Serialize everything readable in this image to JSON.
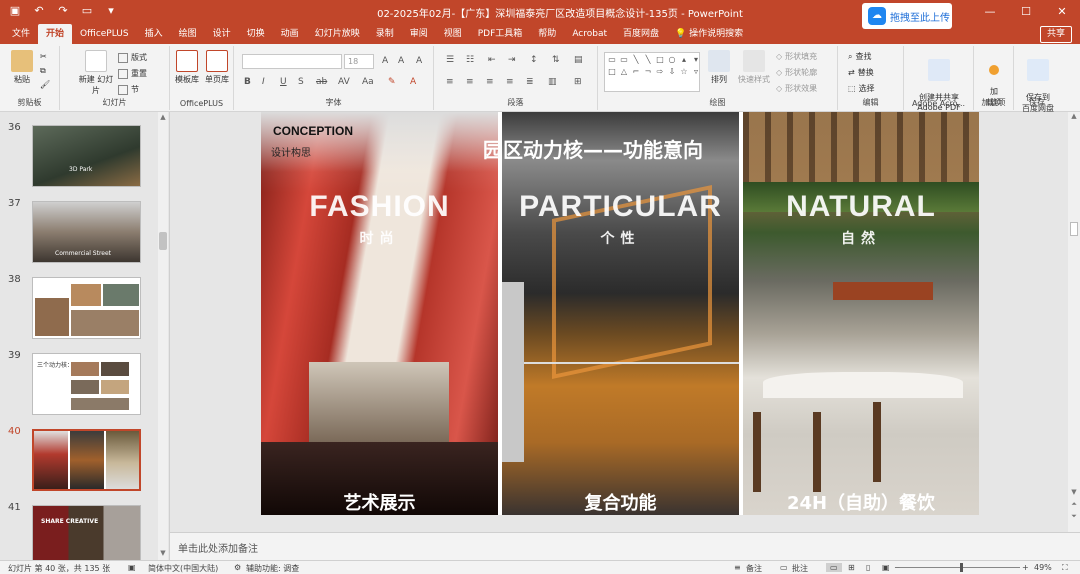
{
  "titlebar": {
    "title": "02-2025年02月-【广东】深圳福泰亮厂区改造项目概念设计-135页  -  PowerPoint",
    "upload": "拖拽至此上传",
    "qat": [
      "save-icon",
      "undo-icon",
      "redo-icon",
      "present-icon",
      "more-icon"
    ]
  },
  "tabs": [
    "文件",
    "开始",
    "OfficePLUS",
    "插入",
    "绘图",
    "设计",
    "切换",
    "动画",
    "幻灯片放映",
    "录制",
    "审阅",
    "视图",
    "PDF工具箱",
    "帮助",
    "Acrobat",
    "百度网盘",
    "操作说明搜索"
  ],
  "active_tab": "开始",
  "share": "共享",
  "ribbon": {
    "clipboard": {
      "paste": "粘贴",
      "label": "剪贴板"
    },
    "slides": {
      "new_slide": "新建\n幻灯片",
      "layout": "版式",
      "reset": "重置",
      "section": "节",
      "label": "幻灯片"
    },
    "officeplus": {
      "template": "模板库",
      "single": "单页库",
      "label": "OfficePLUS"
    },
    "font": {
      "font_size": "18",
      "label": "字体"
    },
    "paragraph": {
      "label": "段落"
    },
    "drawing": {
      "arrange": "排列",
      "quick_style": "快速样式",
      "fill": "形状填充",
      "outline": "形状轮廓",
      "effect": "形状效果",
      "label": "绘图"
    },
    "editing": {
      "find": "查找",
      "replace": "替换",
      "select": "选择",
      "label": "编辑"
    },
    "adobe": {
      "create": "创建并共享\nAdobe PDF",
      "label": "Adobe Acro..."
    },
    "addin": {
      "btn": "加\n载项",
      "label": "加载项"
    },
    "save": {
      "btn": "保存到\n百度网盘",
      "label": "保存"
    }
  },
  "thumbnails": [
    {
      "num": "36",
      "caption": "3D Park"
    },
    {
      "num": "37",
      "caption": "Commercial Street"
    },
    {
      "num": "38",
      "caption": ""
    },
    {
      "num": "39",
      "caption": "三个动力核："
    },
    {
      "num": "40",
      "caption": ""
    },
    {
      "num": "41",
      "caption": "SHARE  CREATIVE"
    }
  ],
  "slide": {
    "conception": "CONCEPTION",
    "conception_sub": "设计构思",
    "heading": "园区动力核——功能意向",
    "panels": [
      {
        "big": "FASHION",
        "sub": "时尚",
        "bottom": "艺术展示"
      },
      {
        "big": "PARTICULAR",
        "sub": "个性",
        "bottom": "复合功能"
      },
      {
        "big": "NATURAL",
        "sub": "自然",
        "bottom": "24H（自助）餐饮"
      }
    ]
  },
  "notes_placeholder": "单击此处添加备注",
  "status": {
    "slide_info": "幻灯片 第 40 张，共 135 张",
    "language": "简体中文(中国大陆)",
    "accessibility": "辅助功能: 调查",
    "notes": "备注",
    "comments": "批注",
    "zoom": "49%"
  },
  "colors": {
    "accent": "#c1462a",
    "ribbon_bg": "#f3f3f3"
  }
}
